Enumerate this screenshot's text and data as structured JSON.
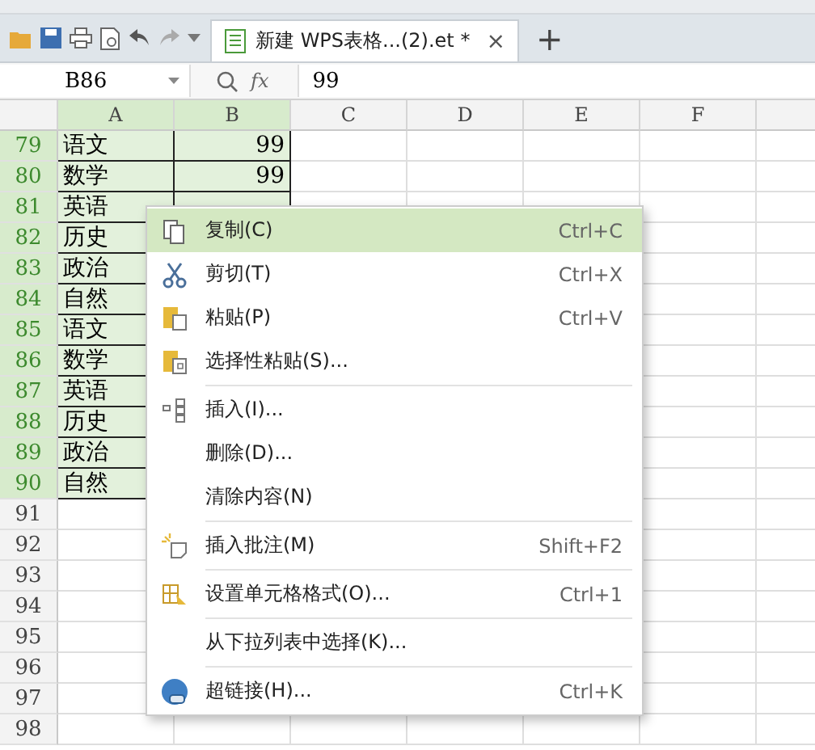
{
  "document_tab": {
    "title": "新建 WPS表格...(2).et *",
    "close": "×",
    "new_tab": "+"
  },
  "formula_bar": {
    "cell_name": "B86",
    "function_label": "fx",
    "value": "99"
  },
  "columns": [
    {
      "label": "A",
      "selected": true
    },
    {
      "label": "B",
      "selected": true
    },
    {
      "label": "C",
      "selected": false
    },
    {
      "label": "D",
      "selected": false
    },
    {
      "label": "E",
      "selected": false
    },
    {
      "label": "F",
      "selected": false
    },
    {
      "selected": false
    }
  ],
  "rows": [
    {
      "number": "79",
      "selected": true,
      "a": "语文",
      "b": "99"
    },
    {
      "number": "80",
      "selected": true,
      "a": "数学",
      "b": "99"
    },
    {
      "number": "81",
      "selected": true,
      "a": "英语"
    },
    {
      "number": "82",
      "selected": true,
      "a": "历史"
    },
    {
      "number": "83",
      "selected": true,
      "a": "政治"
    },
    {
      "number": "84",
      "selected": true,
      "a": "自然"
    },
    {
      "number": "85",
      "selected": true,
      "a": "语文"
    },
    {
      "number": "86",
      "selected": true,
      "a": "数学"
    },
    {
      "number": "87",
      "selected": true,
      "a": "英语"
    },
    {
      "number": "88",
      "selected": true,
      "a": "历史"
    },
    {
      "number": "89",
      "selected": true,
      "a": "政治"
    },
    {
      "number": "90",
      "selected": true,
      "a": "自然"
    },
    {
      "number": "91",
      "selected": false
    },
    {
      "number": "92",
      "selected": false
    },
    {
      "number": "93",
      "selected": false
    },
    {
      "number": "94",
      "selected": false
    },
    {
      "number": "95",
      "selected": false
    },
    {
      "number": "96",
      "selected": false
    },
    {
      "number": "97",
      "selected": false
    },
    {
      "number": "98",
      "selected": false
    }
  ],
  "context_menu": [
    {
      "kind": "copy",
      "label": "复制(C)",
      "shortcut": "Ctrl+C",
      "selected": true
    },
    {
      "kind": "cut",
      "label": "剪切(T)",
      "shortcut": "Ctrl+X",
      "selected": false
    },
    {
      "kind": "paste",
      "label": "粘贴(P)",
      "shortcut": "Ctrl+V",
      "selected": false
    },
    {
      "kind": "paste-special",
      "label": "选择性粘贴(S)...",
      "selected": false,
      "separator_after": true
    },
    {
      "kind": "insert",
      "label": "插入(I)...",
      "selected": false
    },
    {
      "kind": "plain",
      "label": "删除(D)...",
      "selected": false
    },
    {
      "kind": "plain",
      "label": "清除内容(N)",
      "selected": false,
      "separator_after": true
    },
    {
      "kind": "comment",
      "label": "插入批注(M)",
      "shortcut": "Shift+F2",
      "selected": false,
      "separator_after": true
    },
    {
      "kind": "format",
      "label": "设置单元格格式(O)...",
      "shortcut": "Ctrl+1",
      "selected": false,
      "separator_after": true
    },
    {
      "kind": "plain",
      "label": "从下拉列表中选择(K)...",
      "selected": false,
      "separator_after": true
    },
    {
      "kind": "link",
      "label": "超链接(H)...",
      "shortcut": "Ctrl+K",
      "selected": false
    }
  ]
}
